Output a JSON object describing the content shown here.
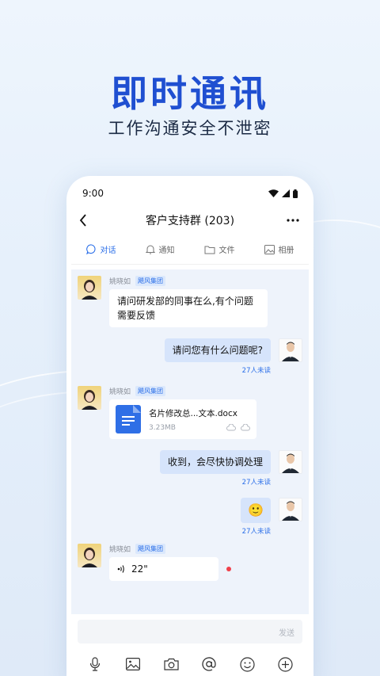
{
  "hero": {
    "title": "即时通讯",
    "subtitle": "工作沟通安全不泄密"
  },
  "status_bar": {
    "time": "9:00"
  },
  "header": {
    "back_icon": "back-chevron-icon",
    "title": "客户支持群 (203)",
    "more_icon": "more-dots-icon"
  },
  "tabs": [
    {
      "label": "对话",
      "icon": "chat-bubble-icon",
      "active": true
    },
    {
      "label": "通知",
      "icon": "bell-icon",
      "active": false
    },
    {
      "label": "文件",
      "icon": "folder-icon",
      "active": false
    },
    {
      "label": "相册",
      "icon": "image-icon",
      "active": false
    }
  ],
  "messages": [
    {
      "side": "left",
      "sender": "姚晓如",
      "org": "飓风集团",
      "type": "text",
      "text": "请问研发部的同事在么,有个问题需要反馈"
    },
    {
      "side": "right",
      "type": "text",
      "text": "请问您有什么问题呢?",
      "unread": "27人未读"
    },
    {
      "side": "left",
      "sender": "姚晓如",
      "org": "飓风集团",
      "type": "file",
      "file_name": "名片修改总...文本.docx",
      "file_size": "3.23MB"
    },
    {
      "side": "right",
      "type": "text",
      "text": "收到，会尽快协调处理",
      "unread": "27人未读"
    },
    {
      "side": "right",
      "type": "emoji",
      "emoji": "🙂",
      "unread": "27人未读"
    },
    {
      "side": "left",
      "sender": "姚晓如",
      "org": "飓风集团",
      "type": "voice",
      "duration": "22\""
    }
  ],
  "input": {
    "send_label": "发送"
  },
  "toolbar": [
    {
      "icon": "microphone-icon"
    },
    {
      "icon": "image-icon"
    },
    {
      "icon": "camera-icon"
    },
    {
      "icon": "at-mention-icon"
    },
    {
      "icon": "emoji-icon"
    },
    {
      "icon": "plus-circle-icon"
    }
  ],
  "colors": {
    "accent": "#2a6ee8",
    "headline": "#1f4fd1",
    "chat_bg": "#eef3fb",
    "bubble_self": "#d6e4fb",
    "voice_unread_dot": "#f0404a"
  }
}
